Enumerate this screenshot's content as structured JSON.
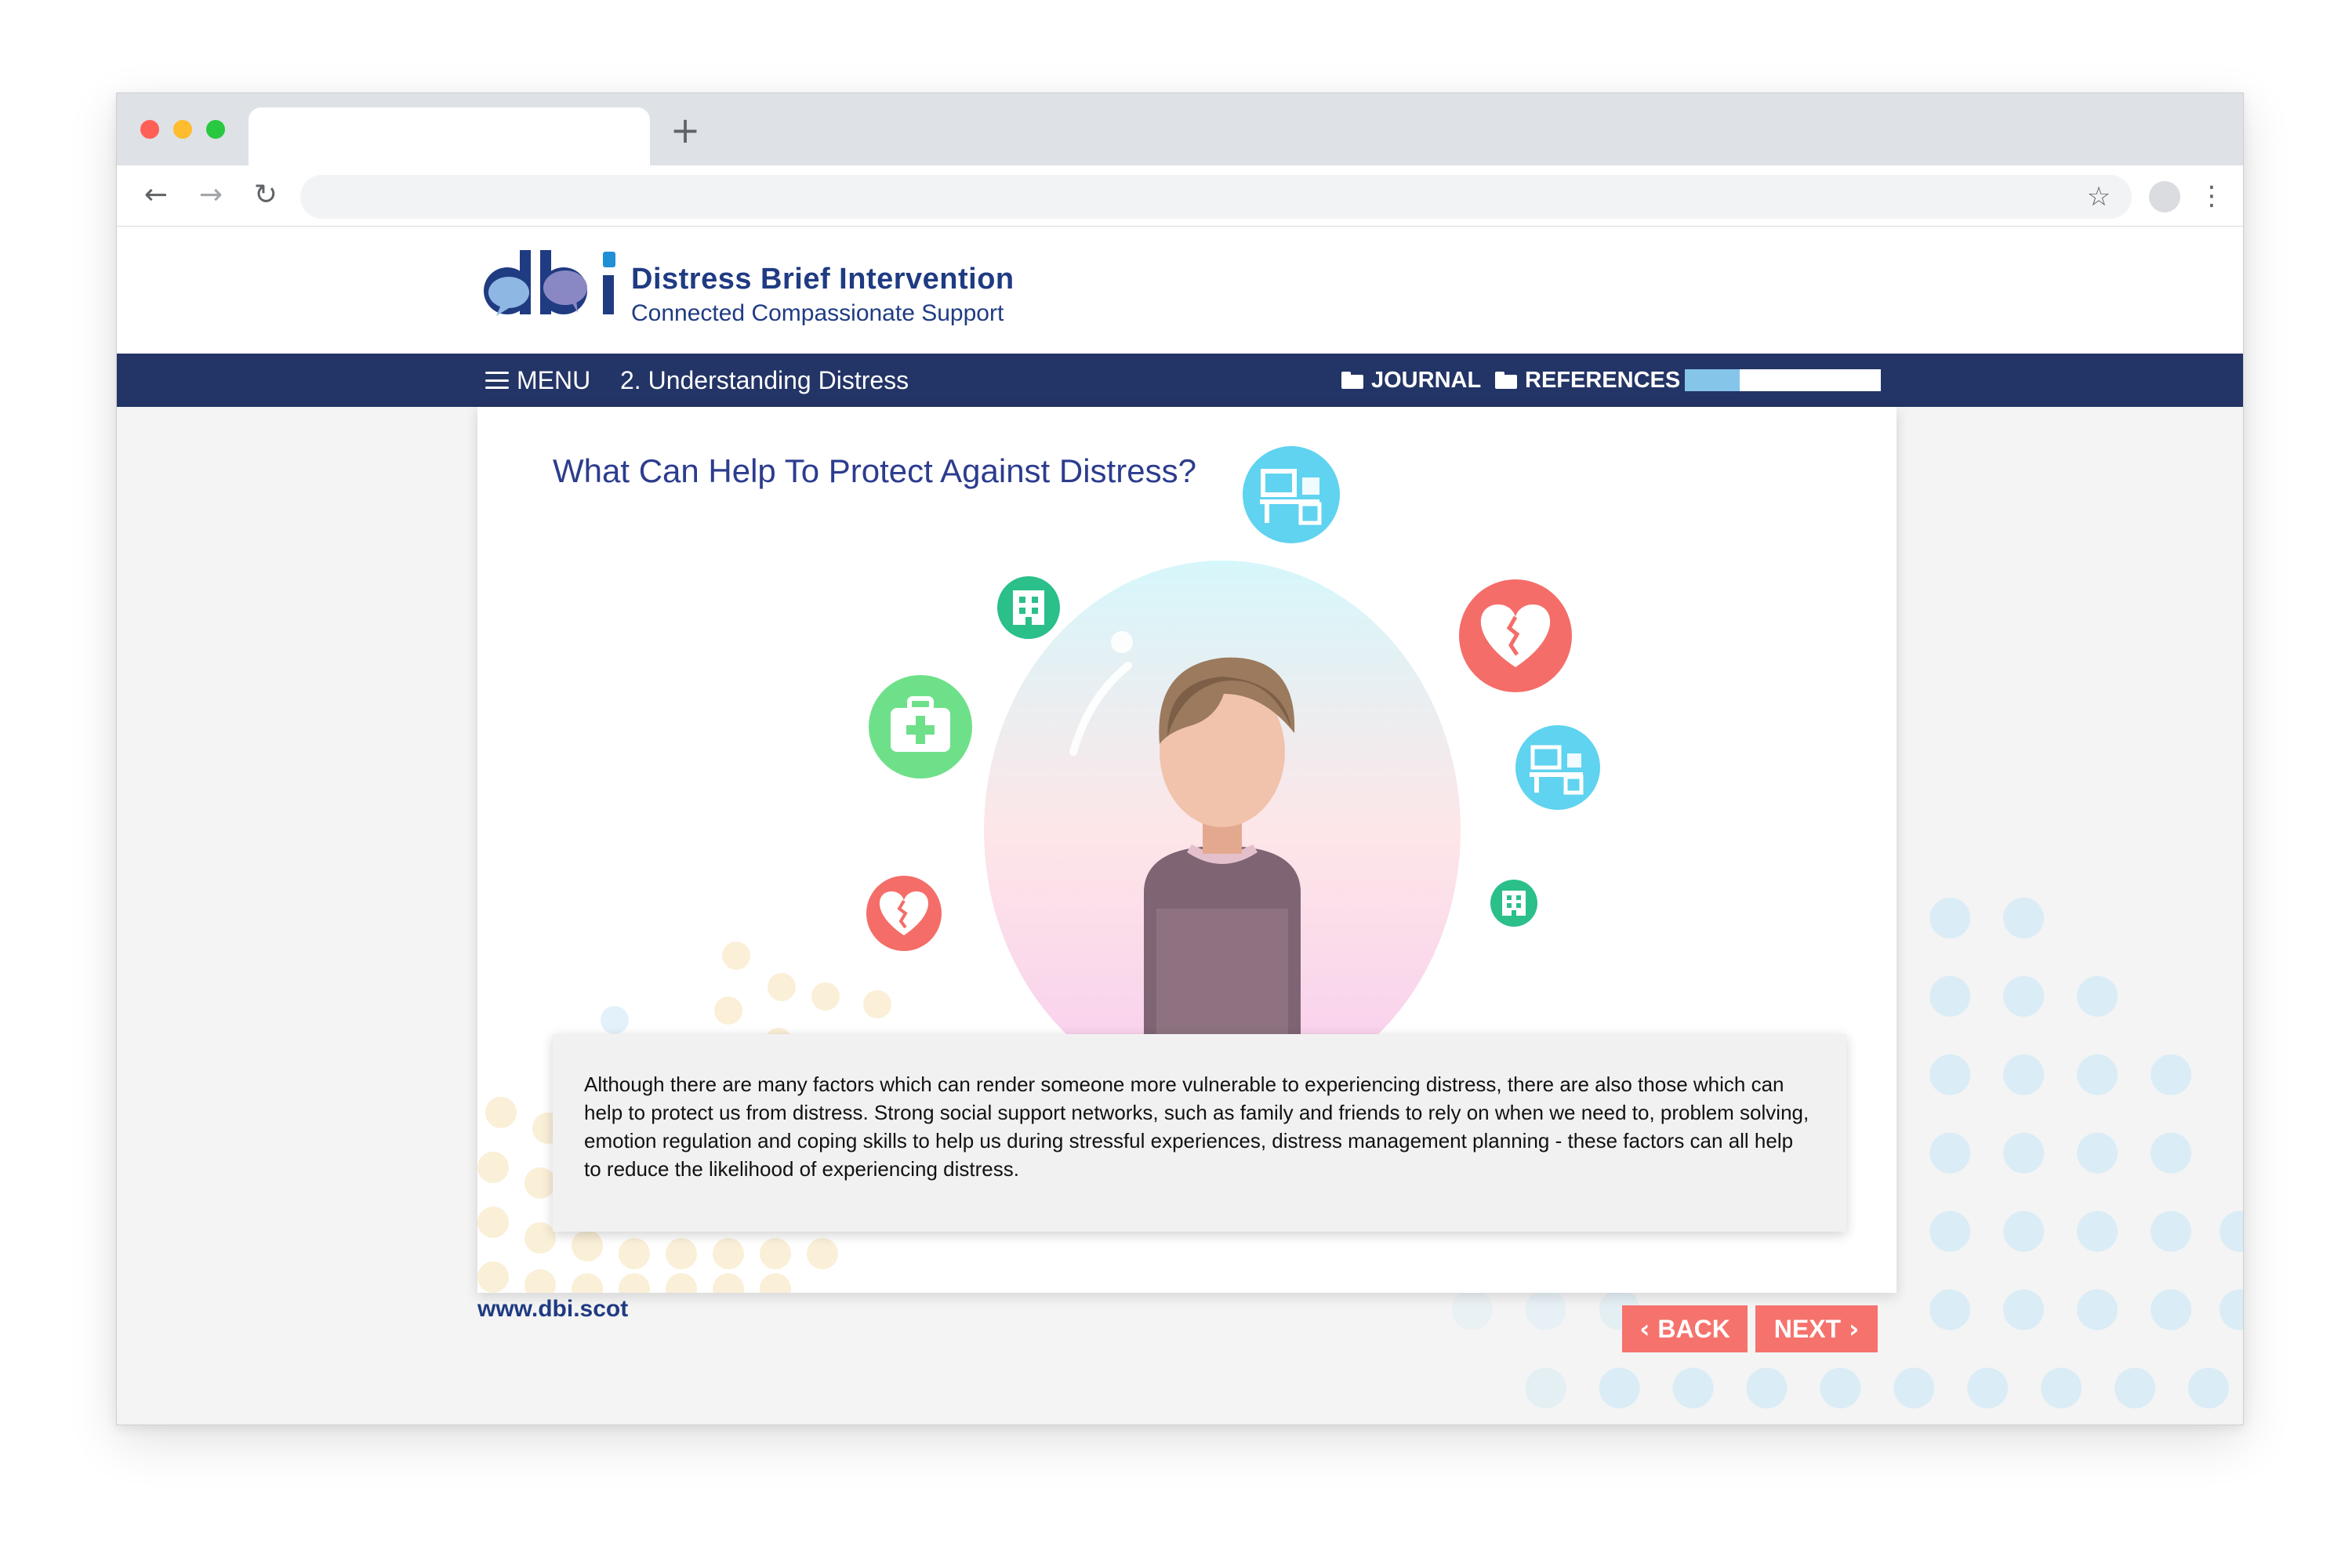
{
  "browser": {
    "new_tab_symbol": "+",
    "back_symbol": "←",
    "forward_symbol": "→",
    "reload_symbol": "↻",
    "bookmark_symbol": "☆",
    "menu_symbol": "⋮"
  },
  "site": {
    "logo_text": "dbi",
    "brand_title": "Distress Brief Intervention",
    "brand_subtitle": "Connected Compassionate Support"
  },
  "navbar": {
    "menu_label": "MENU",
    "section_title": "2. Understanding Distress",
    "journal_label": "JOURNAL",
    "references_label": "REFERENCES",
    "progress_fraction": 0.28
  },
  "content": {
    "title": "What Can Help To Protect Against Distress?",
    "body": "Although there are many factors which can render someone more vulnerable to experiencing distress, there are also those which can help to protect us from distress. Strong social support networks, such as family and friends to rely on when we need to, problem solving, emotion regulation and coping skills to help us during stressful experiences, distress management planning - these factors can all help to reduce the likelihood of experiencing distress."
  },
  "footer": {
    "url": "www.dbi.scot",
    "back_label": "BACK",
    "next_label": "NEXT",
    "back_chevron": "‹",
    "next_chevron": "›"
  },
  "colors": {
    "navbar": "#233466",
    "brand_blue": "#1f3b82",
    "button": "#f6726c",
    "progress": "#86c5ea",
    "icon_blue": "#5fd3f0",
    "icon_green": "#6fe08a",
    "icon_teal": "#2bbf8a",
    "icon_red": "#f46d69"
  },
  "icons": [
    "desk-icon",
    "building-icon",
    "first-aid-icon",
    "broken-heart-icon"
  ]
}
